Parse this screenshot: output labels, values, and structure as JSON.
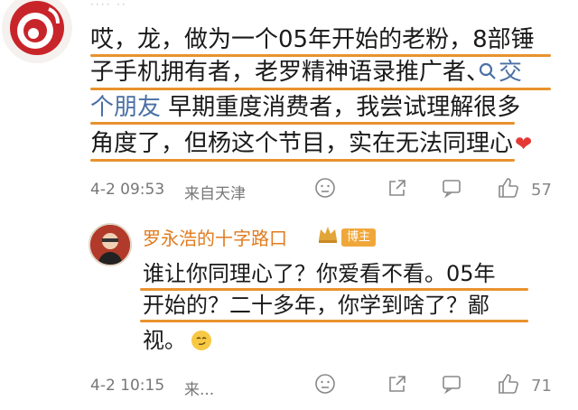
{
  "comment": {
    "handle": "···· ··",
    "lines": [
      "哎，龙，做为一个05年开始的老粉，8部锤",
      "子手机拥有者，老罗精神语录推广者、",
      "早期重度消费者，我尝试理解很多",
      "角度了，但杨这个节目，实在无法同理心"
    ],
    "link_prefix_icon": "search-icon",
    "link_part1": "交",
    "link_part2": "个朋友",
    "heart": "❤",
    "time": "4-2 09:53",
    "location": "来自天津",
    "like_count": "57"
  },
  "reply": {
    "author": "罗永浩的十字路口",
    "badge": "博主",
    "lines": [
      "谁让你同理心了？你爱看不看。05年",
      "开始的？二十多年，你学到啥了？鄙",
      "视。"
    ],
    "time": "4-2 10:15",
    "location": "来...",
    "like_count": "71"
  },
  "colors": {
    "underline": "#e8922e",
    "link": "#4a6fa5",
    "author": "#e07b1f",
    "heart": "#e53935"
  }
}
